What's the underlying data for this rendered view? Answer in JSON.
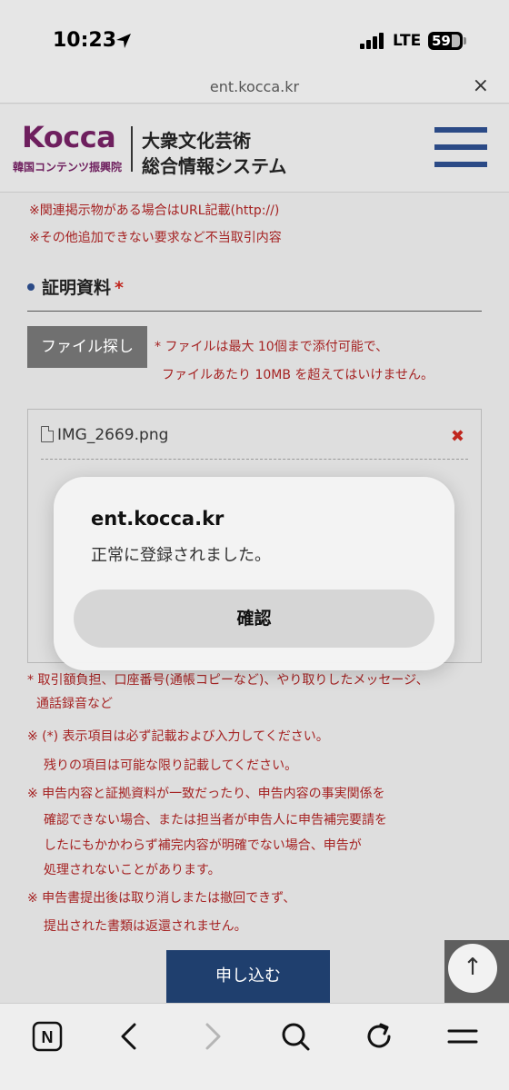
{
  "status": {
    "time": "10:23",
    "network": "LTE",
    "battery": "59"
  },
  "browser": {
    "url": "ent.kocca.kr",
    "close_label": "×"
  },
  "header": {
    "logo": "Kocca",
    "logo_sub": "韓国コンテンツ振興院",
    "title_line1": "大衆文化芸術",
    "title_line2": "総合情報システム"
  },
  "content": {
    "notes_top": [
      "※関連掲示物がある場合はURL記載(http://)",
      "※その他追加できない要求など不当取引内容"
    ],
    "section_title": "証明資料",
    "required_mark": "*",
    "file_button_label": "ファイル探し",
    "file_notes": [
      "* ファイルは最大 10個まで添付可能で、",
      "ファイルあたり 10MB を超えてはいけません。"
    ],
    "file_name": "IMG_2669.png",
    "remove_label": "✖",
    "evidence_notes": [
      "* 取引額負担、口座番号(通帳コピーなど)、やり取りしたメッセージ、",
      "通話録音など"
    ],
    "warnings": [
      "※ (*) 表示項目は必ず記載および入力してください。",
      "残りの項目は可能な限り記載してください。",
      "※ 申告内容と証拠資料が一致だったり、申告内容の事実関係を",
      "確認できない場合、または担当者が申告人に申告補完要請を",
      "したにもかかわらず補完内容が明確でない場合、申告が",
      "処理されないことがあります。",
      "※ 申告書提出後は取り消しまたは撤回できず、",
      "提出された書類は返還されません。"
    ],
    "submit_label": "申し込む",
    "scroll_top_label": "↑"
  },
  "dialog": {
    "title": "ent.kocca.kr",
    "message": "正常に登録されました。",
    "confirm_label": "確認"
  },
  "toolbar": {
    "home_label": "N",
    "icons": [
      "naver-home-icon",
      "back-icon",
      "forward-icon",
      "search-icon",
      "reload-icon",
      "menu-icon"
    ]
  },
  "colors": {
    "brand_purple": "#6e1f5e",
    "navy": "#1f3f6e",
    "note_red": "#a52222"
  }
}
